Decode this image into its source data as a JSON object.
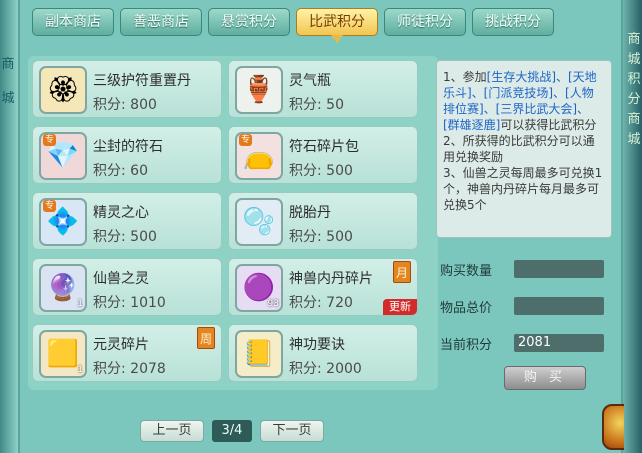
{
  "side": {
    "left_text": [
      "商",
      "城"
    ],
    "right_text": [
      "商",
      "城",
      "积",
      "分",
      "商",
      "城"
    ]
  },
  "tabs": [
    {
      "label": "副本商店",
      "active": false
    },
    {
      "label": "善恶商店",
      "active": false
    },
    {
      "label": "悬赏积分",
      "active": false
    },
    {
      "label": "比武积分",
      "active": true
    },
    {
      "label": "师徒积分",
      "active": false
    },
    {
      "label": "挑战积分",
      "active": false
    }
  ],
  "items": [
    {
      "name": "三级护符重置丹",
      "points": "积分: 800",
      "icon": "golden-amulet-pill-icon",
      "glyph": "🏵"
    },
    {
      "name": "灵气瓶",
      "points": "积分: 50",
      "icon": "spirit-vase-icon",
      "glyph": "🏺"
    },
    {
      "name": "尘封的符石",
      "points": "积分: 60",
      "icon": "sealed-rune-stone-icon",
      "glyph": "💎",
      "zhuan": "专"
    },
    {
      "name": "符石碎片包",
      "points": "积分: 500",
      "icon": "rune-fragment-bag-icon",
      "glyph": "👝",
      "zhuan": "专"
    },
    {
      "name": "精灵之心",
      "points": "积分: 500",
      "icon": "spirit-heart-icon",
      "glyph": "💠",
      "zhuan": "专"
    },
    {
      "name": "脱胎丹",
      "points": "积分: 500",
      "icon": "rebirth-pill-icon",
      "glyph": "🫧"
    },
    {
      "name": "仙兽之灵",
      "points": "积分: 1010",
      "icon": "celestial-beast-orb-icon",
      "glyph": "🔮",
      "count": "1"
    },
    {
      "name": "神兽内丹碎片",
      "points": "积分: 720",
      "icon": "divine-beast-core-shard-icon",
      "glyph": "🟣",
      "count": "93",
      "period": "月",
      "new": "更新"
    },
    {
      "name": "元灵碎片",
      "points": "积分: 2078",
      "icon": "yuanling-shard-icon",
      "glyph": "🟨",
      "count": "1",
      "period": "周"
    },
    {
      "name": "神功要诀",
      "points": "积分: 2000",
      "icon": "secret-manual-book-icon",
      "glyph": "📒"
    }
  ],
  "pager": {
    "prev": "上一页",
    "page": "3/4",
    "next": "下一页"
  },
  "rules": {
    "p1_a": "1、参加",
    "p1_events": "[生存大挑战]、[天地乐斗]、[门派竞技场]、[人物排位赛]、[三界比武大会]、[群雄逐鹿]",
    "p1_b": "可以获得比武积分",
    "p2": "2、所获得的比武积分可以通用兑换奖励",
    "p3": "3、仙兽之灵每周最多可兑换1个，神兽内丹碎片每月最多可兑换5个"
  },
  "form": {
    "qty_label": "购买数量",
    "qty_value": "",
    "total_label": "物品总价",
    "total_value": "",
    "current_label": "当前积分",
    "current_value": "2081"
  },
  "buy_label": "购 买"
}
